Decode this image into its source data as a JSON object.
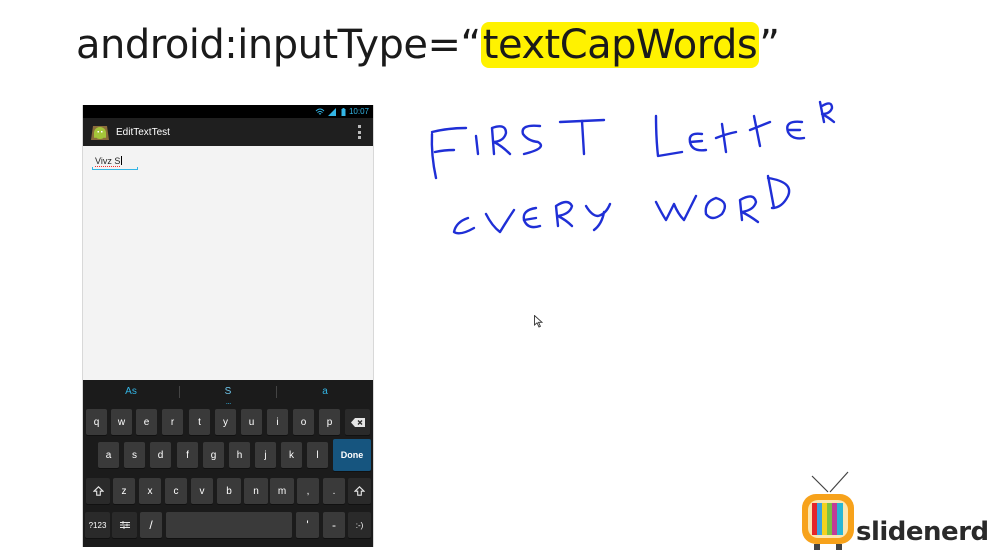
{
  "slide": {
    "title_prefix": "android:inputType=“",
    "title_highlight": "textCapWords",
    "title_suffix": "”"
  },
  "phone": {
    "status_time": "10:07",
    "app_title": "EditTextTest",
    "edit_text_value": "Vivz S"
  },
  "keyboard": {
    "suggestions": [
      "As",
      "S",
      "a"
    ],
    "row1": [
      "q",
      "w",
      "e",
      "r",
      "t",
      "y",
      "u",
      "i",
      "o",
      "p"
    ],
    "row2": [
      "a",
      "s",
      "d",
      "f",
      "g",
      "h",
      "j",
      "k",
      "l"
    ],
    "row3": [
      "z",
      "x",
      "c",
      "v",
      "b",
      "n",
      "m",
      ",",
      "."
    ],
    "done_label": "Done",
    "symbols_label": "?123",
    "slash_label": "/",
    "apostrophe_label": "'",
    "dash_label": "-",
    "smiley_label": ":-)"
  },
  "handwriting": {
    "line1": "FIRST LETTER",
    "line2": "EVERY WORD"
  },
  "logo": {
    "text": "slidenerd"
  },
  "colors": {
    "highlight": "#fff200",
    "ink": "#1f2fd6",
    "holo_blue": "#33b5e5",
    "done_key": "#16557f"
  }
}
